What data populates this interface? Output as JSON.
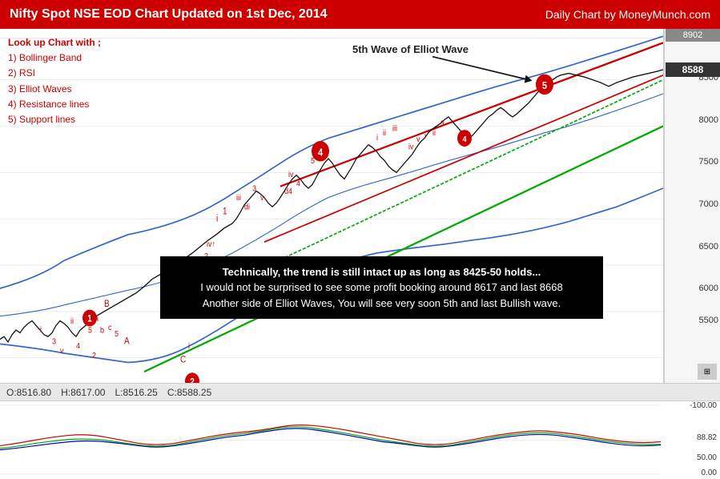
{
  "header": {
    "title": "Nifty Spot NSE EOD  Chart Updated on 1st Dec, 2014",
    "subtitle": "Daily Chart by MoneyMunch.com"
  },
  "lookup": {
    "title": "Look up Chart with ;",
    "items": [
      "1) Bollinger Band",
      "2) RSI",
      "3) Elliot Waves",
      "4) Resistance lines",
      "5) Support lines"
    ]
  },
  "annotation": {
    "line1": "Technically, the trend is still intact up as long as 8425-50 holds...",
    "line2": "I would not be surprised to see some profit booking around 8617 and last 8668",
    "line3": "Another side of Elliot Waves, You will see very soon 5th and last Bullish wave."
  },
  "ohlc": {
    "open_label": "O:",
    "open_val": "8516.80",
    "high_label": "H:",
    "high_val": "8617.00",
    "low_label": "L:",
    "low_val": "8516.25",
    "close_label": "C:",
    "close_val": "8588.25"
  },
  "price_axis": {
    "prices": [
      "8902",
      "8500",
      "8000",
      "7500",
      "7000",
      "6500",
      "6000",
      "5500"
    ],
    "current": "8588",
    "top": "8902"
  },
  "indicator_axis": {
    "labels": [
      "-100.00",
      "88.82",
      "50.00",
      "0.00"
    ]
  },
  "wave_annotation": "5th Wave of Elliot Wave",
  "colors": {
    "header_bg": "#cc0000",
    "red": "#cc0000",
    "green": "#00aa00",
    "blue": "#0000cc",
    "black": "#111111"
  }
}
